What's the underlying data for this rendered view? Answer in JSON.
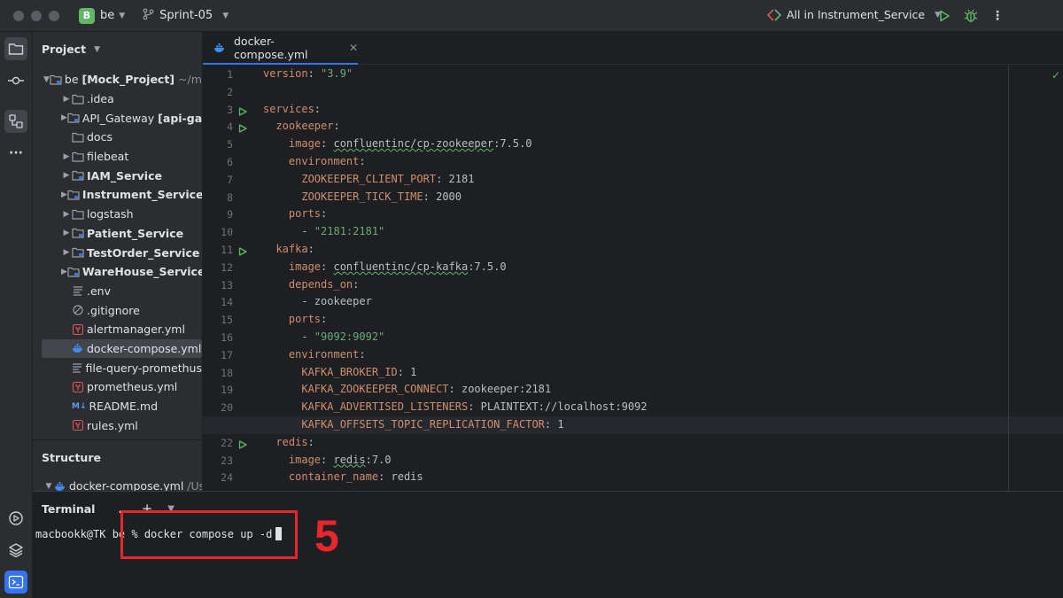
{
  "titlebar": {
    "project_badge": "B",
    "project_name": "be",
    "branch": "Sprint-05",
    "run_config": "All in Instrument_Service",
    "icons": [
      "run-icon",
      "debug-icon",
      "more-icon"
    ]
  },
  "left_strip": [
    "folder-icon",
    "commit-icon",
    "structure-icon",
    "more-icon",
    "services-icon",
    "layers-icon",
    "terminal-icon"
  ],
  "project_panel": {
    "title": "Project",
    "root": {
      "name": "be",
      "module": "[Mock_Project]",
      "path": "~/moc"
    },
    "items": [
      {
        "label": "idea",
        "prefix": ".",
        "kind": "folder",
        "expand": true,
        "bold": false
      },
      {
        "label": "API_Gateway",
        "suffix": "[api-gate",
        "kind": "folder",
        "expand": true,
        "bold": false
      },
      {
        "label": "docs",
        "kind": "folder",
        "expand": false,
        "bold": false
      },
      {
        "label": "filebeat",
        "kind": "folder",
        "expand": true,
        "bold": false
      },
      {
        "label": "IAM_Service",
        "kind": "folder",
        "expand": true,
        "bold": true
      },
      {
        "label": "Instrument_Service",
        "kind": "folder",
        "expand": true,
        "bold": true
      },
      {
        "label": "logstash",
        "kind": "folder",
        "expand": true,
        "bold": false
      },
      {
        "label": "Patient_Service",
        "kind": "folder",
        "expand": true,
        "bold": true
      },
      {
        "label": "TestOrder_Service",
        "kind": "folder",
        "expand": true,
        "bold": true
      },
      {
        "label": "WareHouse_Service",
        "kind": "folder",
        "expand": true,
        "bold": true
      },
      {
        "label": ".env",
        "kind": "text"
      },
      {
        "label": ".gitignore",
        "kind": "ignore"
      },
      {
        "label": "alertmanager.yml",
        "kind": "yaml"
      },
      {
        "label": "docker-compose.yml",
        "kind": "docker",
        "selected": true
      },
      {
        "label": "file-query-promethus",
        "kind": "text"
      },
      {
        "label": "prometheus.yml",
        "kind": "yaml"
      },
      {
        "label": "README.md",
        "kind": "md",
        "badge": "M↓"
      },
      {
        "label": "rules.yml",
        "kind": "yaml"
      }
    ]
  },
  "structure_panel": {
    "title": "Structure",
    "file": "docker-compose.yml",
    "path": "/Us"
  },
  "editor": {
    "tab": "docker-compose.yml",
    "current_line": 21,
    "run_lines": [
      3,
      4,
      11,
      22
    ],
    "lines": [
      {
        "n": "1",
        "segs": [
          [
            "k",
            "version"
          ],
          [
            "v",
            ": "
          ],
          [
            "s",
            "\"3.9\""
          ]
        ]
      },
      {
        "n": "2",
        "segs": []
      },
      {
        "n": "3",
        "segs": [
          [
            "k",
            "services"
          ],
          [
            "v",
            ":"
          ]
        ]
      },
      {
        "n": "4",
        "segs": [
          [
            "v",
            "  "
          ],
          [
            "k",
            "zookeeper"
          ],
          [
            "v",
            ":"
          ]
        ]
      },
      {
        "n": "5",
        "segs": [
          [
            "v",
            "    "
          ],
          [
            "k",
            "image"
          ],
          [
            "v",
            ": "
          ],
          [
            "vu",
            "confluentinc/cp-zookeeper"
          ],
          [
            "v",
            ":7.5.0"
          ]
        ]
      },
      {
        "n": "6",
        "segs": [
          [
            "v",
            "    "
          ],
          [
            "k",
            "environment"
          ],
          [
            "v",
            ":"
          ]
        ]
      },
      {
        "n": "7",
        "segs": [
          [
            "v",
            "      "
          ],
          [
            "k",
            "ZOOKEEPER_CLIENT_PORT"
          ],
          [
            "v",
            ": 2181"
          ]
        ]
      },
      {
        "n": "8",
        "segs": [
          [
            "v",
            "      "
          ],
          [
            "k",
            "ZOOKEEPER_TICK_TIME"
          ],
          [
            "v",
            ": 2000"
          ]
        ]
      },
      {
        "n": "9",
        "segs": [
          [
            "v",
            "    "
          ],
          [
            "k",
            "ports"
          ],
          [
            "v",
            ":"
          ]
        ]
      },
      {
        "n": "10",
        "segs": [
          [
            "v",
            "      - "
          ],
          [
            "s",
            "\"2181:2181\""
          ]
        ]
      },
      {
        "n": "11",
        "segs": [
          [
            "v",
            "  "
          ],
          [
            "k",
            "kafka"
          ],
          [
            "v",
            ":"
          ]
        ]
      },
      {
        "n": "12",
        "segs": [
          [
            "v",
            "    "
          ],
          [
            "k",
            "image"
          ],
          [
            "v",
            ": "
          ],
          [
            "vu",
            "confluentinc/cp-kafka"
          ],
          [
            "v",
            ":7.5.0"
          ]
        ]
      },
      {
        "n": "13",
        "segs": [
          [
            "v",
            "    "
          ],
          [
            "k",
            "depends_on"
          ],
          [
            "v",
            ":"
          ]
        ]
      },
      {
        "n": "14",
        "segs": [
          [
            "v",
            "      - zookeeper"
          ]
        ]
      },
      {
        "n": "15",
        "segs": [
          [
            "v",
            "    "
          ],
          [
            "k",
            "ports"
          ],
          [
            "v",
            ":"
          ]
        ]
      },
      {
        "n": "16",
        "segs": [
          [
            "v",
            "      - "
          ],
          [
            "s",
            "\"9092:9092\""
          ]
        ]
      },
      {
        "n": "17",
        "segs": [
          [
            "v",
            "    "
          ],
          [
            "k",
            "environment"
          ],
          [
            "v",
            ":"
          ]
        ]
      },
      {
        "n": "18",
        "segs": [
          [
            "v",
            "      "
          ],
          [
            "k",
            "KAFKA_BROKER_ID"
          ],
          [
            "v",
            ": 1"
          ]
        ]
      },
      {
        "n": "19",
        "segs": [
          [
            "v",
            "      "
          ],
          [
            "k",
            "KAFKA_ZOOKEEPER_CONNECT"
          ],
          [
            "v",
            ": zookeeper:2181"
          ]
        ]
      },
      {
        "n": "20",
        "segs": [
          [
            "v",
            "      "
          ],
          [
            "k",
            "KAFKA_ADVERTISED_LISTENERS"
          ],
          [
            "v",
            ": PLAINTEXT://localhost:9092"
          ]
        ]
      },
      {
        "n": "21",
        "segs": [
          [
            "v",
            "      "
          ],
          [
            "k",
            "KAFKA_OFFSETS_TOPIC_REPLICATION_FACTOR"
          ],
          [
            "v",
            ": 1"
          ]
        ]
      },
      {
        "n": "22",
        "segs": [
          [
            "v",
            "  "
          ],
          [
            "k",
            "redis"
          ],
          [
            "v",
            ":"
          ]
        ]
      },
      {
        "n": "23",
        "segs": [
          [
            "v",
            "    "
          ],
          [
            "k",
            "image"
          ],
          [
            "v",
            ": "
          ],
          [
            "vu",
            "redis"
          ],
          [
            "v",
            ":7.0"
          ]
        ]
      },
      {
        "n": "24",
        "segs": [
          [
            "v",
            "    "
          ],
          [
            "k",
            "container_name"
          ],
          [
            "v",
            ": redis"
          ]
        ]
      }
    ]
  },
  "terminal": {
    "title": "Terminal",
    "more": "...",
    "add": "+",
    "prompt": "macbookk@TK be % ",
    "command": "docker compose up -d"
  },
  "annotation": {
    "step_number": "5",
    "color": "#e8262c"
  },
  "colors": {
    "keyword": "#cf8e6d",
    "string": "#6aab73",
    "accent": "#3574f0",
    "run": "#5fb865"
  }
}
